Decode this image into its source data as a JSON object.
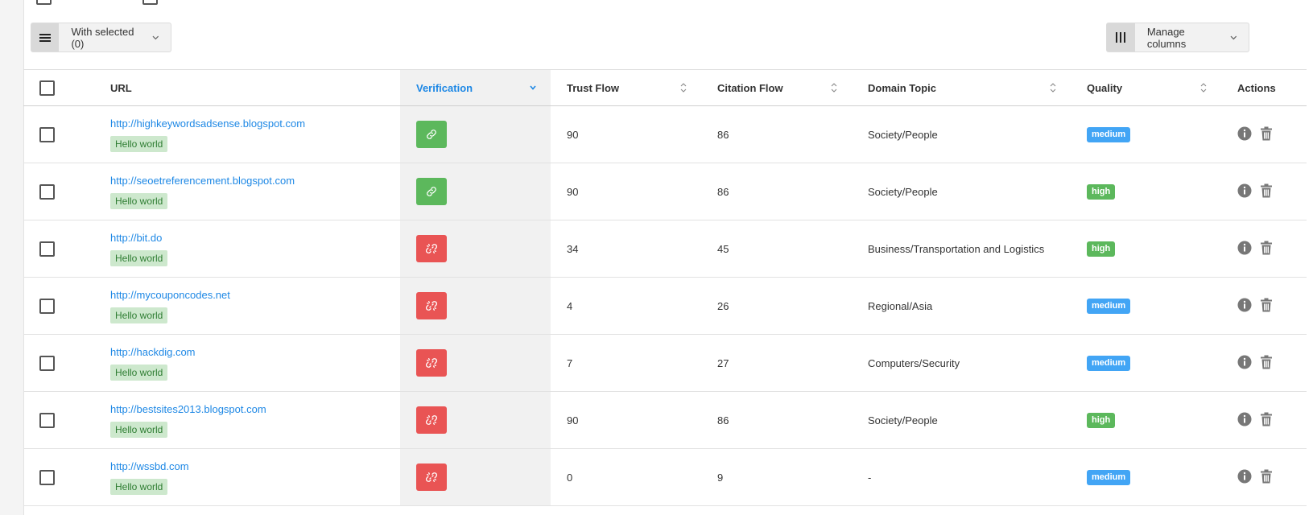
{
  "toolbar": {
    "with_selected_label": "With selected (0)",
    "manage_columns_label": "Manage columns"
  },
  "table": {
    "headers": {
      "url": "URL",
      "verification": "Verification",
      "trust_flow": "Trust Flow",
      "citation_flow": "Citation Flow",
      "domain_topic": "Domain Topic",
      "quality": "Quality",
      "actions": "Actions"
    },
    "rows": [
      {
        "url": "http://highkeywordsadsense.blogspot.com",
        "tag": "Hello world",
        "verified": "ok",
        "trust_flow": "90",
        "citation_flow": "86",
        "domain_topic": "Society/People",
        "quality": "medium"
      },
      {
        "url": "http://seoetreferencement.blogspot.com",
        "tag": "Hello world",
        "verified": "ok",
        "trust_flow": "90",
        "citation_flow": "86",
        "domain_topic": "Society/People",
        "quality": "high"
      },
      {
        "url": "http://bit.do",
        "tag": "Hello world",
        "verified": "bad",
        "trust_flow": "34",
        "citation_flow": "45",
        "domain_topic": "Business/Transportation and Logistics",
        "quality": "high"
      },
      {
        "url": "http://mycouponcodes.net",
        "tag": "Hello world",
        "verified": "bad",
        "trust_flow": "4",
        "citation_flow": "26",
        "domain_topic": "Regional/Asia",
        "quality": "medium"
      },
      {
        "url": "http://hackdig.com",
        "tag": "Hello world",
        "verified": "bad",
        "trust_flow": "7",
        "citation_flow": "27",
        "domain_topic": "Computers/Security",
        "quality": "medium"
      },
      {
        "url": "http://bestsites2013.blogspot.com",
        "tag": "Hello world",
        "verified": "bad",
        "trust_flow": "90",
        "citation_flow": "86",
        "domain_topic": "Society/People",
        "quality": "high"
      },
      {
        "url": "http://wssbd.com",
        "tag": "Hello world",
        "verified": "bad",
        "trust_flow": "0",
        "citation_flow": "9",
        "domain_topic": "-",
        "quality": "medium"
      }
    ]
  },
  "colors": {
    "link": "#1e88e5",
    "verified_ok": "#5cb85c",
    "verified_bad": "#e95454",
    "quality_medium": "#42a5f5",
    "quality_high": "#5cb85c"
  },
  "icons": {
    "toolbar_menu": "hamburger-icon",
    "manage_columns": "columns-icon",
    "dropdown": "chevron-down-icon",
    "verified_ok": "link-icon",
    "verified_bad": "broken-link-icon",
    "info": "info-icon",
    "delete": "trash-icon",
    "sort": "sort-icon",
    "sort_active": "sort-desc-icon"
  }
}
